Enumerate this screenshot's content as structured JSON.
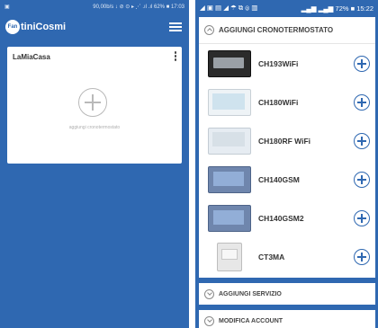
{
  "left_phone": {
    "status_bar": {
      "left_icon": "image-icon",
      "right_text": "90,00b/s ↓ ⊘ ⊙ ▸ ⋰ .ıl .ıl 62% ■ 17:03"
    },
    "app_bar": {
      "logo_badge": "Fan",
      "logo_text": "tiniCosmi",
      "menu_icon": "hamburger-menu-icon"
    },
    "home_card": {
      "title": "LaMiaCasa",
      "add_caption": "aggiungi cronotermostato"
    }
  },
  "right_phone": {
    "status_bar": {
      "left_icons": "◢ ▣ ▤ ◢ ☂ ⧉ ⦾ ▥",
      "right_text": "▂▄▆ ▂▄▆ 72% ■ 15:22"
    },
    "section_header": {
      "label": "AGGIUNGI CRONOTERMOSTATO"
    },
    "devices": [
      {
        "name": "CH193WiFi",
        "thumb": "dark"
      },
      {
        "name": "CH180WiFi",
        "thumb": "lcd"
      },
      {
        "name": "CH180RF WiFi",
        "thumb": "lcd2"
      },
      {
        "name": "CH140GSM",
        "thumb": "blue"
      },
      {
        "name": "CH140GSM2",
        "thumb": "blue"
      },
      {
        "name": "CT3MA",
        "thumb": "box"
      }
    ],
    "sections": [
      {
        "label": "AGGIUNGI SERVIZIO"
      },
      {
        "label": "MODIFICA ACCOUNT"
      }
    ]
  },
  "colors": {
    "brand_blue": "#2f68b1",
    "card_white": "#ffffff"
  }
}
